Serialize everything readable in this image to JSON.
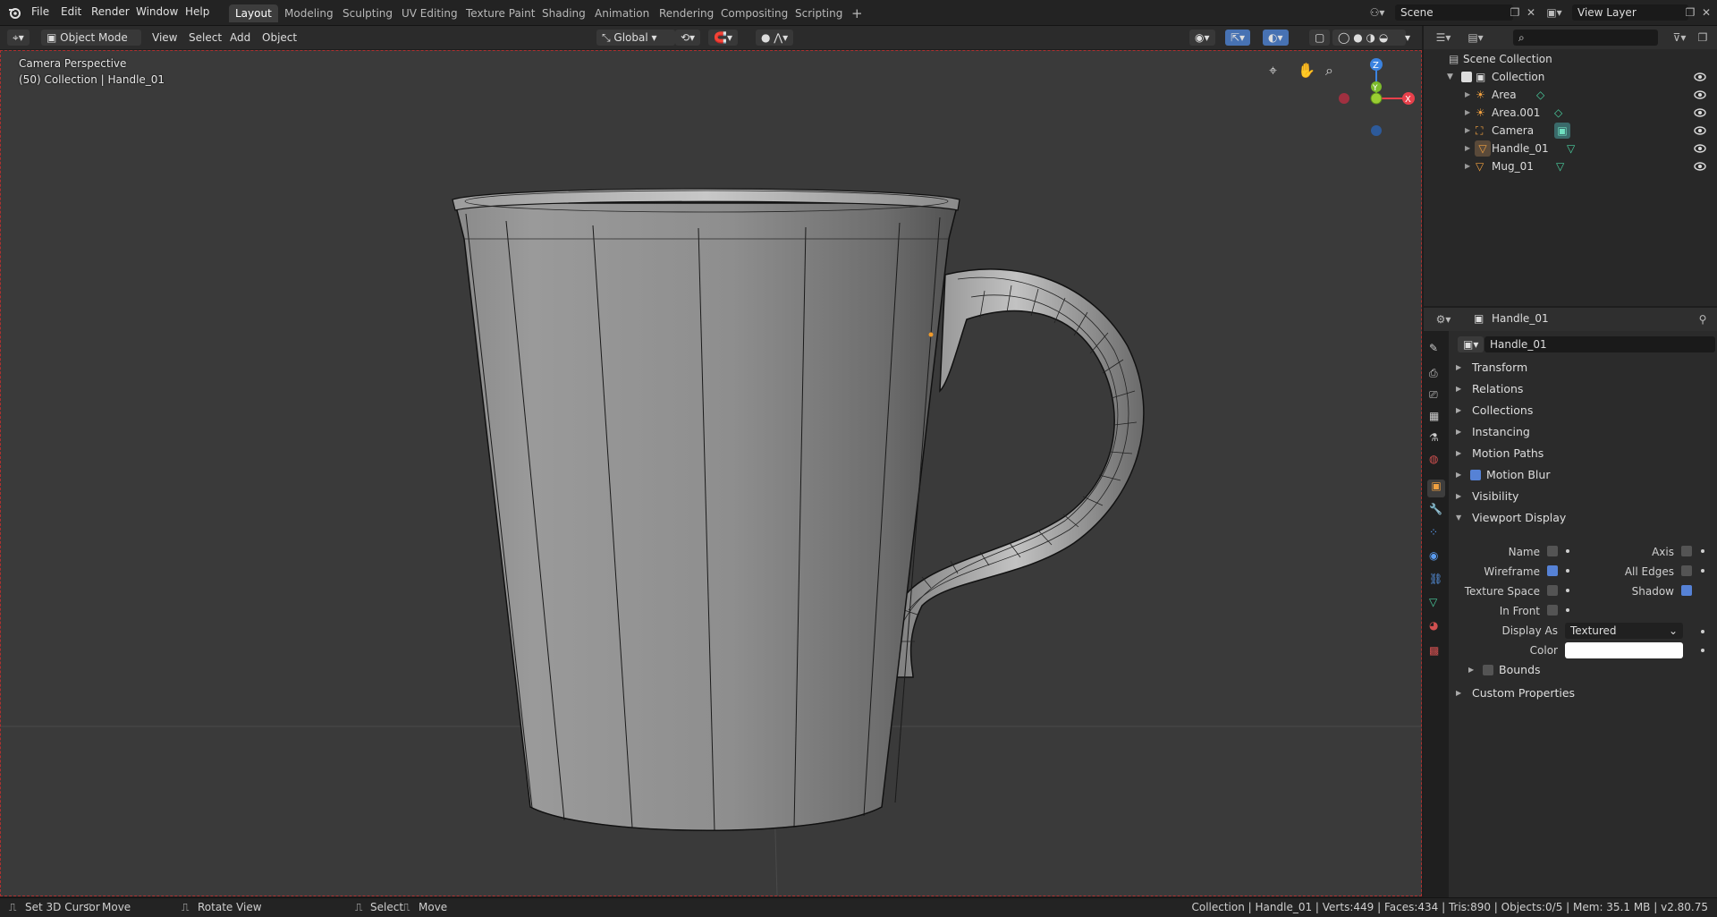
{
  "menu": {
    "items": [
      "File",
      "Edit",
      "Render",
      "Window",
      "Help"
    ]
  },
  "workspaces": {
    "tabs": [
      "Layout",
      "Modeling",
      "Sculpting",
      "UV Editing",
      "Texture Paint",
      "Shading",
      "Animation",
      "Rendering",
      "Compositing",
      "Scripting"
    ],
    "active": "Layout"
  },
  "scene": {
    "name": "Scene"
  },
  "view_layer": {
    "name": "View Layer"
  },
  "viewport_header": {
    "mode": "Object Mode",
    "menus": [
      "View",
      "Select",
      "Add",
      "Object"
    ],
    "transform_orientation": "Global"
  },
  "viewport": {
    "camera_label": "Camera Perspective",
    "collection_label": "(50) Collection | Handle_01"
  },
  "gizmo": {
    "z": "Z",
    "x": "X",
    "y": "Y"
  },
  "outliner": {
    "root": "Scene Collection",
    "collection": "Collection",
    "items": [
      "Area",
      "Area.001",
      "Camera",
      "Handle_01",
      "Mug_01"
    ]
  },
  "properties": {
    "object_name": "Handle_01",
    "data_name": "Handle_01",
    "panels": [
      "Transform",
      "Relations",
      "Collections",
      "Instancing",
      "Motion Paths",
      "Motion Blur",
      "Visibility",
      "Viewport Display",
      "Custom Properties"
    ],
    "viewport_display": {
      "name": "Name",
      "axis": "Axis",
      "wireframe": "Wireframe",
      "all_edges": "All Edges",
      "texture_space": "Texture Space",
      "shadow": "Shadow",
      "in_front": "In Front",
      "display_as_label": "Display As",
      "display_as": "Textured",
      "color_label": "Color",
      "bounds": "Bounds"
    }
  },
  "status": {
    "left": [
      "Set 3D Cursor",
      "Move",
      "Rotate View",
      "Select",
      "Move"
    ],
    "right": "Collection | Handle_01 | Verts:449 | Faces:434 | Tris:890 | Objects:0/5 | Mem: 35.1 MB | v2.80.75"
  },
  "colors": {
    "accent": "#5682d6",
    "axis_x": "#e8404b",
    "axis_y": "#7cbb2c",
    "axis_z": "#3b83e0",
    "selection_dashed": "#b03030"
  }
}
